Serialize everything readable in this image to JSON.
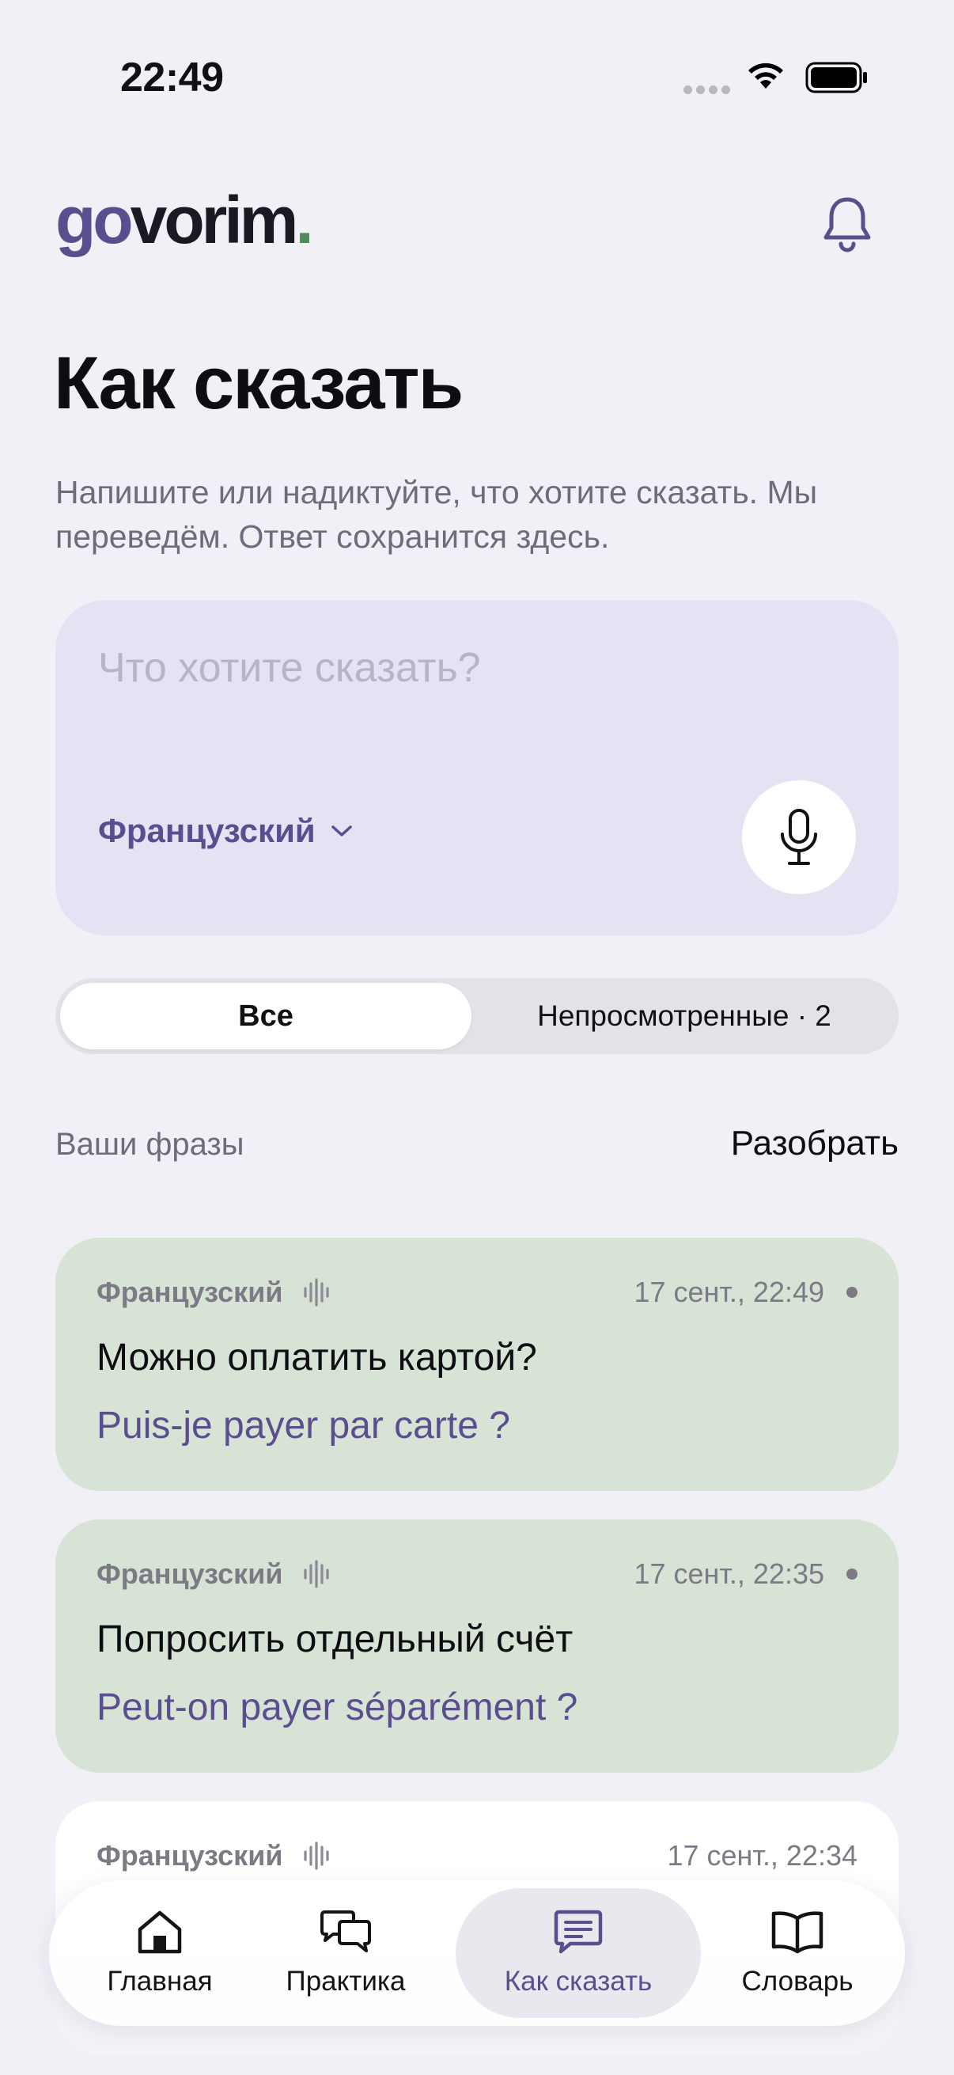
{
  "status_bar": {
    "time": "22:49"
  },
  "header": {
    "logo_go": "go",
    "logo_rest": "vorim",
    "logo_dot": "."
  },
  "page": {
    "title": "Как сказать",
    "subtitle": "Напишите или надиктуйте, что хотите сказать. Мы переведём. Ответ сохранится здесь."
  },
  "input": {
    "placeholder": "Что хотите сказать?",
    "language": "Французский"
  },
  "filter": {
    "all_label": "Все",
    "unseen_label": "Непросмотренные · 2",
    "selected": "Все"
  },
  "section": {
    "title": "Ваши фразы",
    "action": "Разобрать"
  },
  "phrases": [
    {
      "language": "Французский",
      "time": "17 сент., 22:49",
      "unread": true,
      "ru": "Можно оплатить картой?",
      "fr": "Puis-je payer par carte ?"
    },
    {
      "language": "Французский",
      "time": "17 сент., 22:35",
      "unread": true,
      "ru": "Попросить отдельный счёт",
      "fr": "Peut-on payer séparément ?"
    },
    {
      "language": "Французский",
      "time": "17 сент., 22:34",
      "unread": false,
      "ru": "",
      "fr": ""
    }
  ],
  "tabs": [
    {
      "label": "Главная",
      "icon": "home-icon"
    },
    {
      "label": "Практика",
      "icon": "chat-bubbles-icon"
    },
    {
      "label": "Как сказать",
      "icon": "message-icon",
      "active": true
    },
    {
      "label": "Словарь",
      "icon": "book-icon"
    }
  ],
  "colors": {
    "accent": "#5b4e8f",
    "card_green": "#d6e3d5",
    "input_bg": "#e5e2f4",
    "background": "#f1f0f6"
  }
}
